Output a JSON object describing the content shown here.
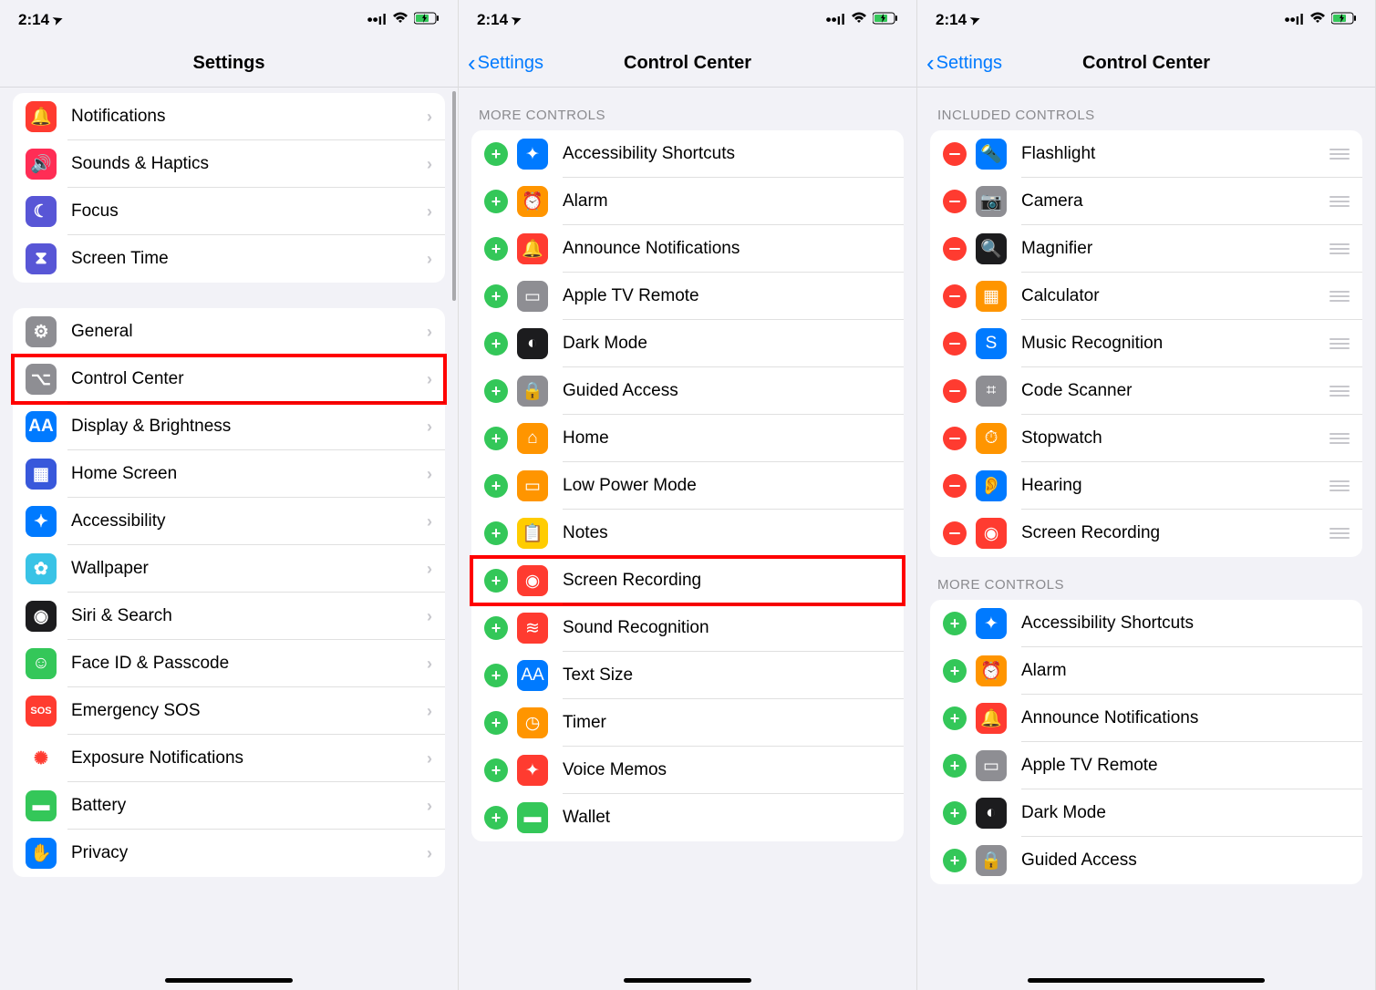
{
  "status": {
    "time": "2:14",
    "location_arrow": "➤"
  },
  "screen1": {
    "title": "Settings",
    "group1": [
      {
        "label": "Notifications",
        "icon": "🔔",
        "color": "#ff3b30",
        "name": "notifications"
      },
      {
        "label": "Sounds & Haptics",
        "icon": "🔊",
        "color": "#ff2d55",
        "name": "sounds-haptics"
      },
      {
        "label": "Focus",
        "icon": "☾",
        "color": "#5856d6",
        "name": "focus"
      },
      {
        "label": "Screen Time",
        "icon": "⧗",
        "color": "#5856d6",
        "name": "screen-time"
      }
    ],
    "group2": [
      {
        "label": "General",
        "icon": "⚙",
        "color": "#8e8e93",
        "name": "general"
      },
      {
        "label": "Control Center",
        "icon": "⌥",
        "color": "#8e8e93",
        "name": "control-center",
        "highlight": true
      },
      {
        "label": "Display & Brightness",
        "icon": "AA",
        "color": "#007aff",
        "name": "display-brightness"
      },
      {
        "label": "Home Screen",
        "icon": "▦",
        "color": "#3858db",
        "name": "home-screen"
      },
      {
        "label": "Accessibility",
        "icon": "✦",
        "color": "#007aff",
        "name": "accessibility"
      },
      {
        "label": "Wallpaper",
        "icon": "✿",
        "color": "#39c3e6",
        "name": "wallpaper"
      },
      {
        "label": "Siri & Search",
        "icon": "◉",
        "color": "#1c1c1e",
        "name": "siri-search"
      },
      {
        "label": "Face ID & Passcode",
        "icon": "☺",
        "color": "#34c759",
        "name": "face-id"
      },
      {
        "label": "Emergency SOS",
        "icon": "SOS",
        "color": "#ff3b30",
        "name": "emergency-sos",
        "small": true
      },
      {
        "label": "Exposure Notifications",
        "icon": "✺",
        "color": "#ffffff",
        "fg": "#ff3b30",
        "name": "exposure"
      },
      {
        "label": "Battery",
        "icon": "▬",
        "color": "#34c759",
        "name": "battery"
      },
      {
        "label": "Privacy",
        "icon": "✋",
        "color": "#007aff",
        "name": "privacy"
      }
    ]
  },
  "screen2": {
    "back": "Settings",
    "title": "Control Center",
    "section": "MORE CONTROLS",
    "items": [
      {
        "label": "Accessibility Shortcuts",
        "icon": "✦",
        "color": "#007aff",
        "name": "accessibility-shortcuts"
      },
      {
        "label": "Alarm",
        "icon": "⏰",
        "color": "#ff9500",
        "name": "alarm"
      },
      {
        "label": "Announce Notifications",
        "icon": "🔔",
        "color": "#ff3b30",
        "name": "announce-notifications"
      },
      {
        "label": "Apple TV Remote",
        "icon": "▭",
        "color": "#8e8e93",
        "name": "apple-tv-remote"
      },
      {
        "label": "Dark Mode",
        "icon": "◐",
        "color": "#1c1c1e",
        "name": "dark-mode"
      },
      {
        "label": "Guided Access",
        "icon": "🔒",
        "color": "#8e8e93",
        "name": "guided-access"
      },
      {
        "label": "Home",
        "icon": "⌂",
        "color": "#ff9500",
        "name": "home"
      },
      {
        "label": "Low Power Mode",
        "icon": "▭",
        "color": "#ff9500",
        "name": "low-power"
      },
      {
        "label": "Notes",
        "icon": "📋",
        "color": "#ffcc00",
        "name": "notes"
      },
      {
        "label": "Screen Recording",
        "icon": "◉",
        "color": "#ff3b30",
        "name": "screen-recording",
        "highlight": true
      },
      {
        "label": "Sound Recognition",
        "icon": "≋",
        "color": "#ff3b30",
        "name": "sound-recognition"
      },
      {
        "label": "Text Size",
        "icon": "AA",
        "color": "#007aff",
        "name": "text-size"
      },
      {
        "label": "Timer",
        "icon": "◷",
        "color": "#ff9500",
        "name": "timer"
      },
      {
        "label": "Voice Memos",
        "icon": "✦",
        "color": "#ff3b30",
        "name": "voice-memos"
      },
      {
        "label": "Wallet",
        "icon": "▬",
        "color": "#34c759",
        "name": "wallet"
      }
    ]
  },
  "screen3": {
    "back": "Settings",
    "title": "Control Center",
    "section1": "INCLUDED CONTROLS",
    "included": [
      {
        "label": "Flashlight",
        "icon": "🔦",
        "color": "#007aff",
        "name": "flashlight"
      },
      {
        "label": "Camera",
        "icon": "📷",
        "color": "#8e8e93",
        "name": "camera"
      },
      {
        "label": "Magnifier",
        "icon": "🔍",
        "color": "#1c1c1e",
        "name": "magnifier"
      },
      {
        "label": "Calculator",
        "icon": "▦",
        "color": "#ff9500",
        "name": "calculator"
      },
      {
        "label": "Music Recognition",
        "icon": "S",
        "color": "#007aff",
        "name": "music-recognition"
      },
      {
        "label": "Code Scanner",
        "icon": "⌗",
        "color": "#8e8e93",
        "name": "code-scanner"
      },
      {
        "label": "Stopwatch",
        "icon": "⏱",
        "color": "#ff9500",
        "name": "stopwatch"
      },
      {
        "label": "Hearing",
        "icon": "👂",
        "color": "#007aff",
        "name": "hearing"
      },
      {
        "label": "Screen Recording",
        "icon": "◉",
        "color": "#ff3b30",
        "name": "screen-recording"
      }
    ],
    "section2": "MORE CONTROLS",
    "more": [
      {
        "label": "Accessibility Shortcuts",
        "icon": "✦",
        "color": "#007aff",
        "name": "accessibility-shortcuts"
      },
      {
        "label": "Alarm",
        "icon": "⏰",
        "color": "#ff9500",
        "name": "alarm"
      },
      {
        "label": "Announce Notifications",
        "icon": "🔔",
        "color": "#ff3b30",
        "name": "announce-notifications"
      },
      {
        "label": "Apple TV Remote",
        "icon": "▭",
        "color": "#8e8e93",
        "name": "apple-tv-remote"
      },
      {
        "label": "Dark Mode",
        "icon": "◐",
        "color": "#1c1c1e",
        "name": "dark-mode"
      },
      {
        "label": "Guided Access",
        "icon": "🔒",
        "color": "#8e8e93",
        "name": "guided-access"
      }
    ]
  }
}
